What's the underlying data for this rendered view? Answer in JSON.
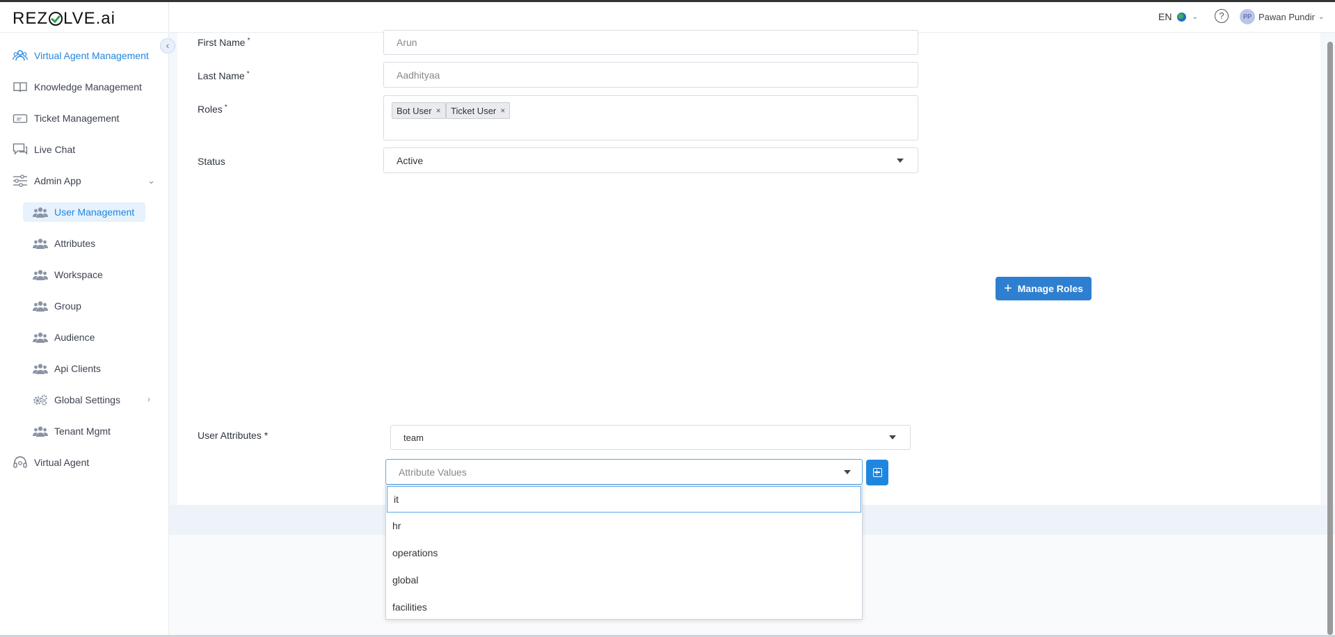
{
  "header": {
    "logo_text_a": "REZ",
    "logo_text_b": "LVE.ai",
    "language": "EN",
    "user_initials": "PP",
    "user_name": "Pawan Pundir"
  },
  "sidebar": {
    "items": [
      {
        "label": "Virtual Agent Management",
        "icon": "people-outline-icon"
      },
      {
        "label": "Knowledge Management",
        "icon": "book-icon"
      },
      {
        "label": "Ticket Management",
        "icon": "ticket-icon"
      },
      {
        "label": "Live Chat",
        "icon": "chat-icon"
      },
      {
        "label": "Admin App",
        "icon": "sliders-icon"
      }
    ],
    "admin_sub": [
      {
        "label": "User Management"
      },
      {
        "label": "Attributes"
      },
      {
        "label": "Workspace"
      },
      {
        "label": "Group"
      },
      {
        "label": "Audience"
      },
      {
        "label": "Api Clients"
      },
      {
        "label": "Global Settings"
      },
      {
        "label": "Tenant Mgmt"
      }
    ],
    "bottom_item": {
      "label": "Virtual Agent",
      "icon": "headset-icon"
    }
  },
  "form": {
    "first_name_label": "First Name",
    "first_name_value": "Arun",
    "last_name_label": "Last Name",
    "last_name_value": "Aadhityaa",
    "roles_label": "Roles",
    "roles": [
      "Bot User",
      "Ticket User"
    ],
    "status_label": "Status",
    "status_value": "Active",
    "required_mark": "*",
    "manage_roles_label": "Manage Roles",
    "user_attributes_label": "User Attributes *",
    "attribute_key_value": "team",
    "attribute_values_placeholder": "Attribute Values"
  },
  "dropdown": {
    "search_value": "it",
    "options": [
      "hr",
      "operations",
      "global",
      "facilities"
    ]
  },
  "colors": {
    "accent": "#1f86e0",
    "button": "#2f7fd0",
    "selected_bg": "#e6f2fd"
  }
}
